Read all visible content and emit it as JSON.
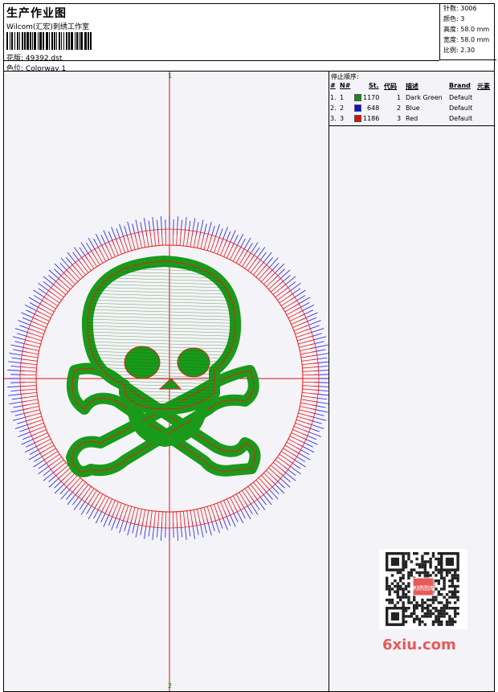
{
  "header": {
    "title": "生产作业图",
    "company": "Wilcom(汇宏)刺绣工作室",
    "pattern_label": "花版:",
    "pattern_value": "49392.dst",
    "colorway_label": "色位:",
    "colorway_value": "Colorway 1"
  },
  "stats": {
    "stitches_label": "针数:",
    "stitches_value": "3006",
    "colors_label": "颜色:",
    "colors_value": "3",
    "height_label": "高度:",
    "height_value": "58.0 mm",
    "width_label": "宽度:",
    "width_value": "58.0 mm",
    "scale_label": "比例:",
    "scale_value": "2.30"
  },
  "stop_sequence": {
    "title": "停止顺序:",
    "columns": [
      "#",
      "N#",
      "St.",
      "代码",
      "描述",
      "Brand",
      "元素"
    ],
    "rows": [
      {
        "n": "1.",
        "num": "1",
        "color": "#1a8a1a",
        "stitches": "1170",
        "code": "1",
        "desc": "Dark Green",
        "brand": "Default"
      },
      {
        "n": "2.",
        "num": "2",
        "color": "#1010dd",
        "stitches": "648",
        "code": "2",
        "desc": "Blue",
        "brand": "Default"
      },
      {
        "n": "3.",
        "num": "3",
        "color": "#dd1010",
        "stitches": "1186",
        "code": "3",
        "desc": "Red",
        "brand": "Default"
      }
    ]
  },
  "design": {
    "axis_top_label": "1",
    "axis_bottom_label": "2",
    "thread_colors": {
      "green": "#1a9a1a",
      "blue": "#1a1aee",
      "red": "#ee1a1a",
      "axis": "#dd1010"
    }
  },
  "watermark": {
    "text": "6xiu.com",
    "stamp": "刺绣图库"
  }
}
